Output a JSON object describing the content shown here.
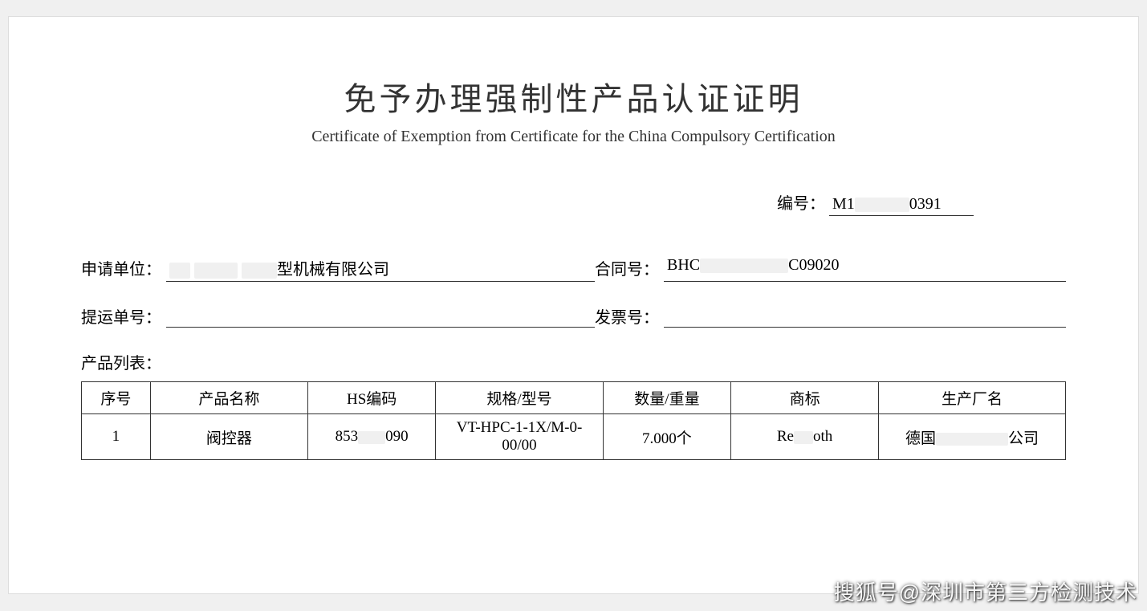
{
  "title_cn": "免予办理强制性产品认证证明",
  "title_en": "Certificate of Exemption from Certificate for the China Compulsory Certification",
  "docno": {
    "label": "编号：",
    "prefix": "M1",
    "suffix": "0391"
  },
  "fields": {
    "applicant_label": "申请单位：",
    "applicant_suffix": "型机械有限公司",
    "contract_label": "合同号：",
    "contract_prefix": "BHC",
    "contract_suffix": "C09020",
    "bill_label": "提运单号：",
    "bill_value": "",
    "invoice_label": "发票号：",
    "invoice_value": ""
  },
  "product_list_label": "产品列表：",
  "table": {
    "headers": [
      "序号",
      "产品名称",
      "HS编码",
      "规格/型号",
      "数量/重量",
      "商标",
      "生产厂名"
    ],
    "row": {
      "seq": "1",
      "name": "阀控器",
      "hs_prefix": "853",
      "hs_suffix": "090",
      "model": "VT-HPC-1-1X/M-0-00/00",
      "qty": "7.000个",
      "brand_prefix": "Re",
      "brand_suffix": "oth",
      "mfr_prefix": "德国",
      "mfr_suffix": "公司"
    }
  },
  "watermark": "搜狐号@深圳市第三方检测技术"
}
